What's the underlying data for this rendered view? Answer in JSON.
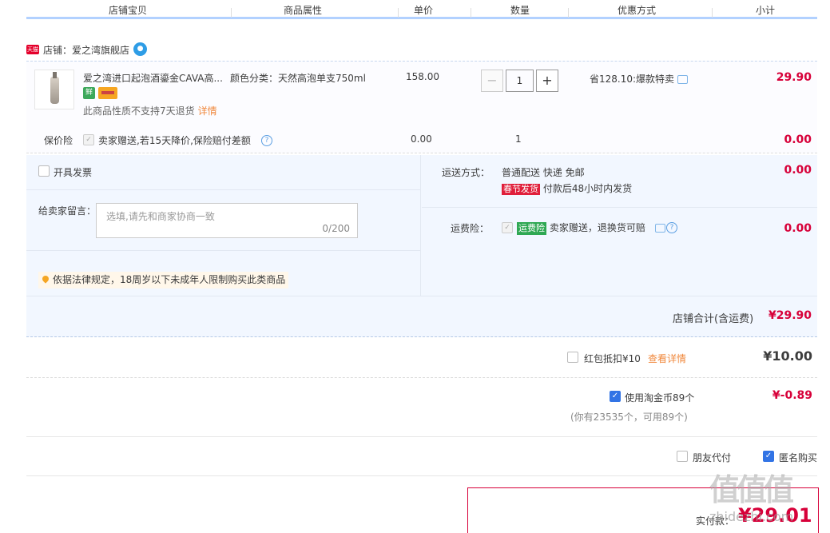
{
  "header": {
    "col_item": "店铺宝贝",
    "col_attr": "商品属性",
    "col_price": "单价",
    "col_qty": "数量",
    "col_promo": "优惠方式",
    "col_subtotal": "小计"
  },
  "shop": {
    "logo_text": "天猫",
    "label": "店铺：爱之湾旗舰店"
  },
  "item": {
    "title": "爱之湾进口起泡酒鎏金CAVA高...",
    "badge_text": "鲜",
    "no_return": "此商品性质不支持7天退货",
    "detail_link": "详情",
    "attr": "颜色分类：天然高泡单支750ml",
    "price": "158.00",
    "qty": "1",
    "qty_minus": "−",
    "qty_plus": "+",
    "promo": "省128.10:爆款特卖",
    "subtotal": "29.90"
  },
  "insurance": {
    "label": "保价险",
    "check": "✓",
    "text": "卖家赠送,若15天降价,保险赔付差额",
    "help": "?",
    "price": "0.00",
    "qty": "1",
    "subtotal": "0.00"
  },
  "options": {
    "invoice_label": "开具发票",
    "message_label": "给卖家留言：",
    "message_placeholder": "选填,请先和商家协商一致",
    "message_count": "0/200",
    "legal_notice": "依据法律规定，18周岁以下未成年人限制购买此类商品",
    "shipping_label": "运送方式：",
    "shipping_value": "普通配送 快递 免邮",
    "holiday_tag": "春节发货",
    "shipping_time": "付款后48小时内发货",
    "shipping_fee": "0.00",
    "freight_ins_label": "运费险：",
    "freight_ins_tag": "运费险",
    "freight_ins_text": "卖家赠送，退换货可赔",
    "freight_ins_fee": "0.00",
    "shop_total_label": "店铺合计(含运费)",
    "shop_total": "¥29.90"
  },
  "redpacket": {
    "label": "红包抵扣¥10",
    "link": "查看详情",
    "amount": "¥10.00"
  },
  "taojinbi": {
    "check": "✓",
    "label": "使用淘金币89个",
    "note": "(你有23535个，可用89个)",
    "amount": "¥-0.89"
  },
  "extra": {
    "friend_pay": "朋友代付",
    "anon_check": "✓",
    "anonymous": "匿名购买"
  },
  "payment": {
    "label": "实付款：",
    "amount": "¥29.01"
  },
  "watermark": {
    "text": "值值值",
    "domain": "zhidezhi.com"
  },
  "colors": {
    "accent_red": "#d70039",
    "blue": "#3274e5",
    "header_border": "#b2d1ff"
  }
}
